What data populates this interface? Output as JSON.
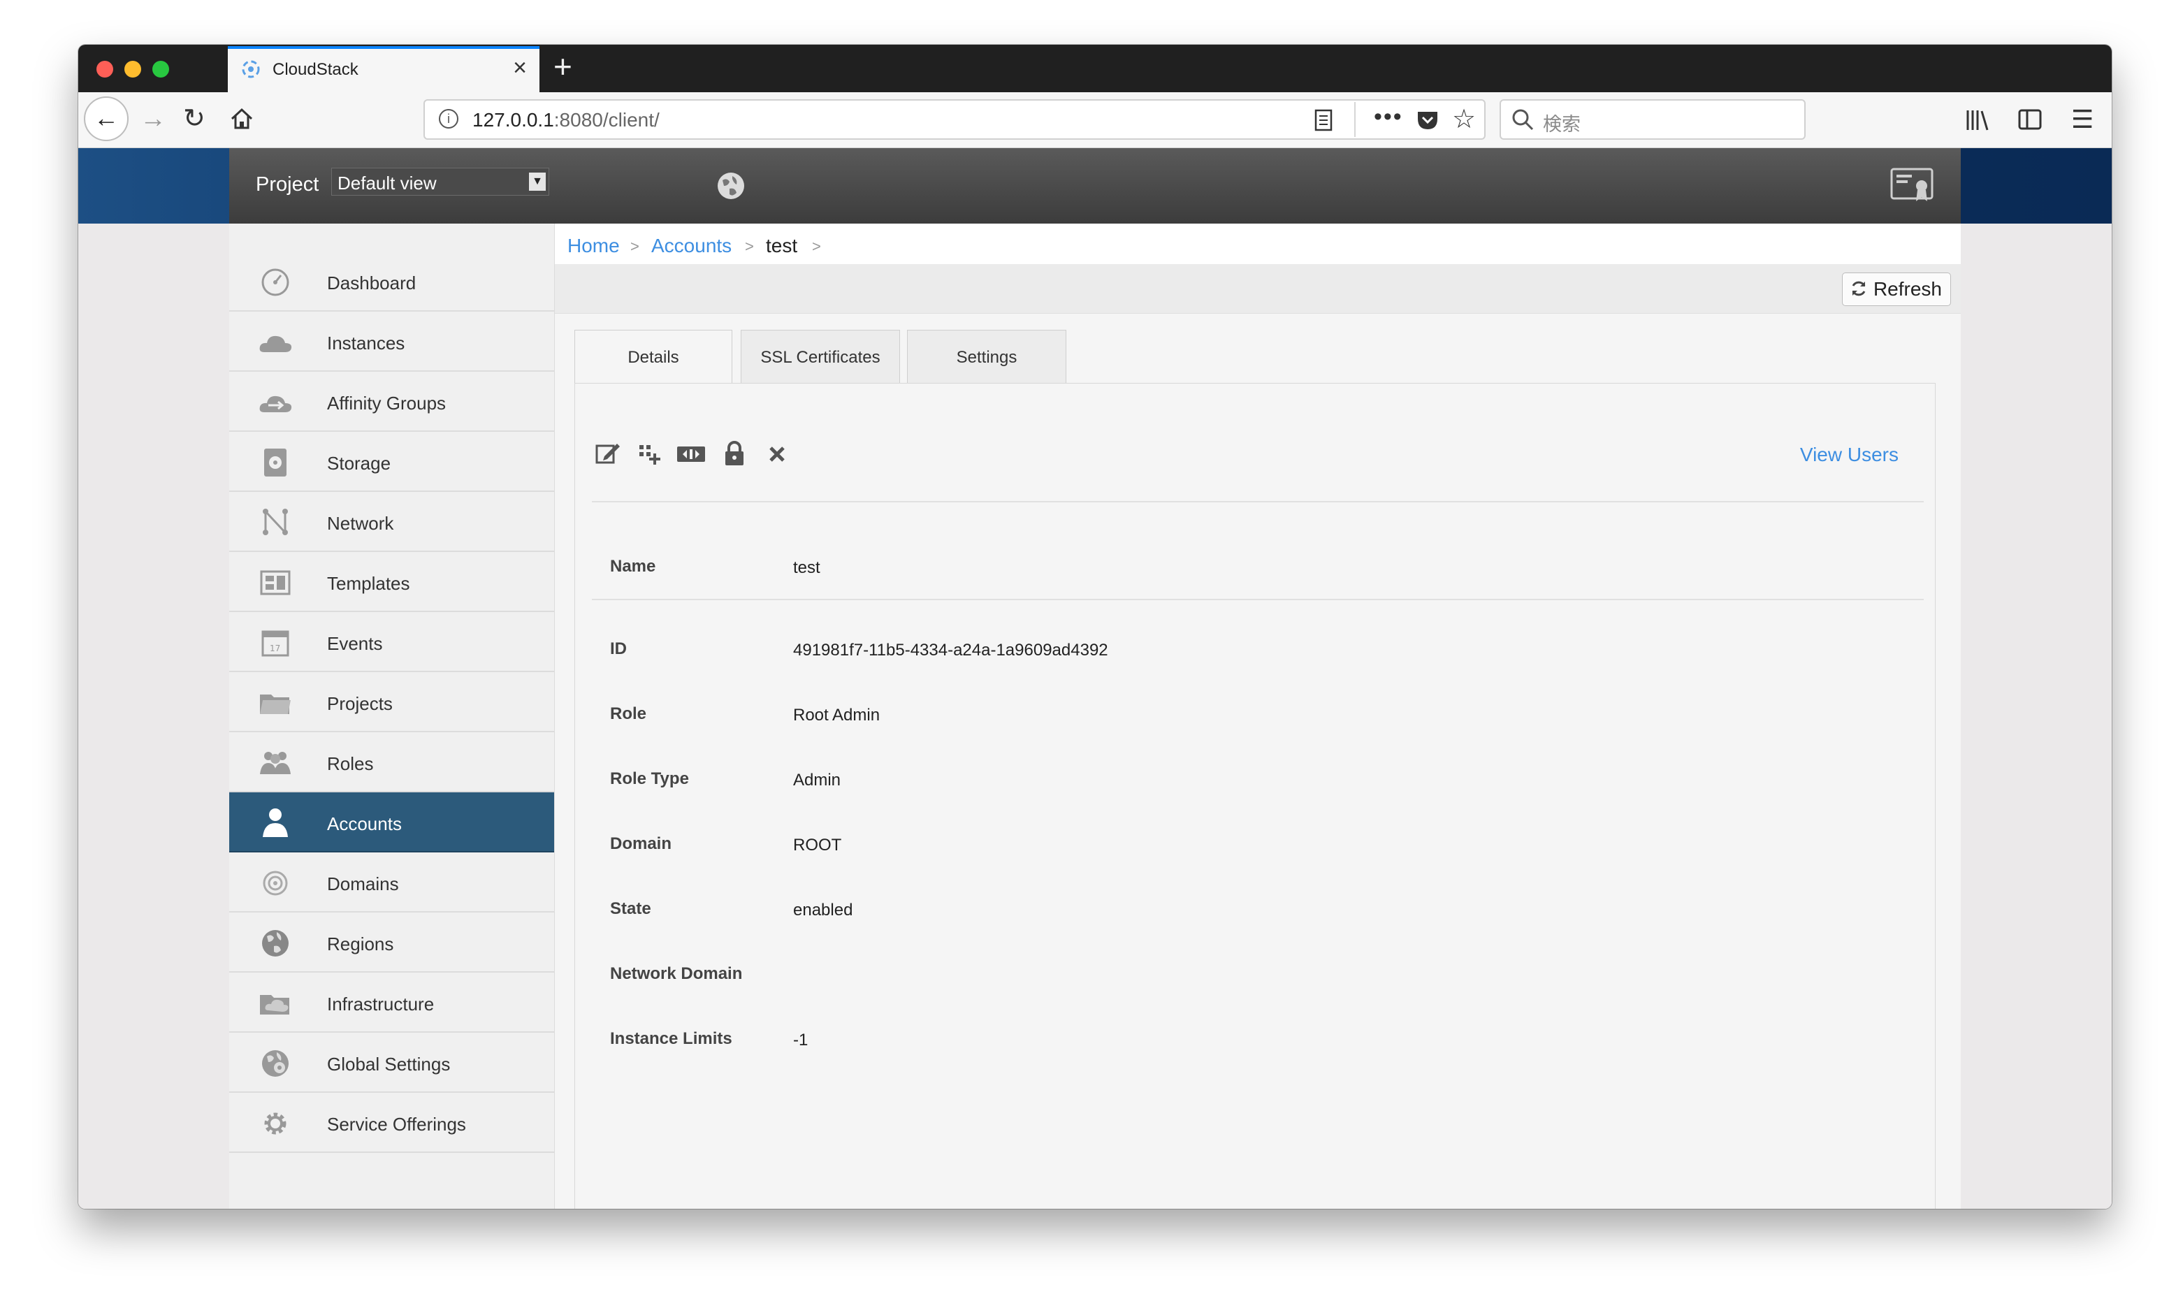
{
  "browser": {
    "tab_title": "CloudStack",
    "url_host": "127.0.0.1",
    "url_rest": ":8080/client/",
    "search_placeholder": "検索"
  },
  "header": {
    "project_label": "Project",
    "project_value": "Default view"
  },
  "sidebar": {
    "items": [
      {
        "label": "Dashboard",
        "icon": "dashboard-gauge-icon"
      },
      {
        "label": "Instances",
        "icon": "cloud-icon"
      },
      {
        "label": "Affinity Groups",
        "icon": "affinity-cloud-icon"
      },
      {
        "label": "Storage",
        "icon": "disk-icon"
      },
      {
        "label": "Network",
        "icon": "network-icon"
      },
      {
        "label": "Templates",
        "icon": "templates-icon"
      },
      {
        "label": "Events",
        "icon": "calendar-icon"
      },
      {
        "label": "Projects",
        "icon": "folder-icon"
      },
      {
        "label": "Roles",
        "icon": "users-group-icon"
      },
      {
        "label": "Accounts",
        "icon": "user-icon",
        "active": true
      },
      {
        "label": "Domains",
        "icon": "target-icon"
      },
      {
        "label": "Regions",
        "icon": "globe-icon"
      },
      {
        "label": "Infrastructure",
        "icon": "infrastructure-icon"
      },
      {
        "label": "Global Settings",
        "icon": "globe-settings-icon"
      },
      {
        "label": "Service Offerings",
        "icon": "gear-icon"
      }
    ]
  },
  "breadcrumb": {
    "home": "Home",
    "accounts": "Accounts",
    "current": "test",
    "sep": ">"
  },
  "toolbar": {
    "refresh_label": "Refresh"
  },
  "tabs": [
    "Details",
    "SSL Certificates",
    "Settings"
  ],
  "actions": {
    "view_users": "View Users"
  },
  "details": [
    {
      "key": "Name",
      "value": "test"
    },
    {
      "key": "ID",
      "value": "491981f7-11b5-4334-a24a-1a9609ad4392"
    },
    {
      "key": "Role",
      "value": "Root Admin"
    },
    {
      "key": "Role Type",
      "value": "Admin"
    },
    {
      "key": "Domain",
      "value": "ROOT"
    },
    {
      "key": "State",
      "value": "enabled"
    },
    {
      "key": "Network Domain",
      "value": ""
    },
    {
      "key": "Instance Limits",
      "value": "-1"
    }
  ],
  "colors": {
    "accent_link": "#3d8ee1",
    "active_nav": "#2c5a7b",
    "header_dark": "#3c3c3c"
  }
}
